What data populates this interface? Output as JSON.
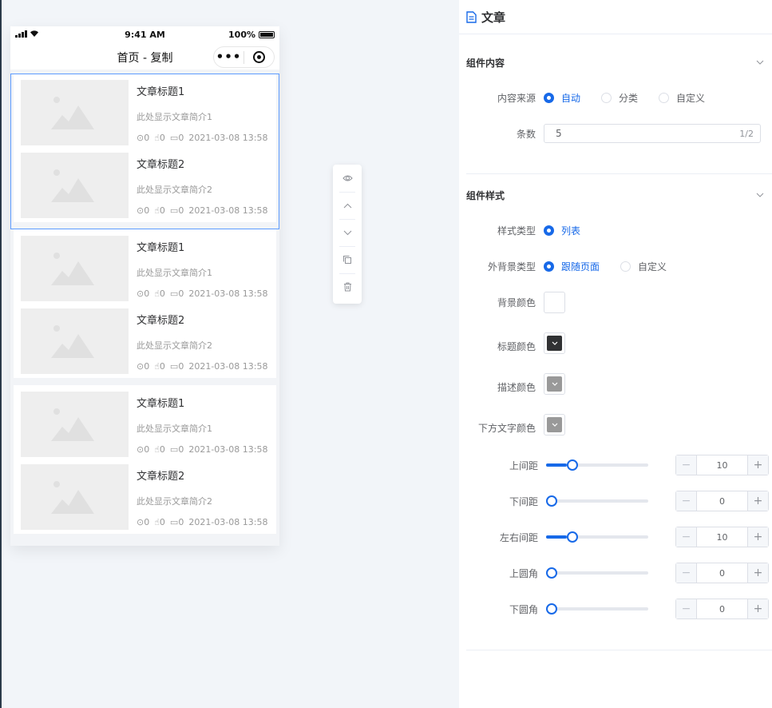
{
  "statusbar": {
    "time": "9:41 AM",
    "battery": "100%"
  },
  "navbar": {
    "title": "首页 - 复制",
    "more_icon": "more-dots-icon",
    "capsule_icon": "target-icon"
  },
  "blocks": [
    {
      "articles": [
        {
          "title": "文章标题1",
          "desc": "此处显示文章简介1",
          "views": "0",
          "likes": "0",
          "comments": "0",
          "time": "2021-03-08 13:58"
        },
        {
          "title": "文章标题2",
          "desc": "此处显示文章简介2",
          "views": "0",
          "likes": "0",
          "comments": "0",
          "time": "2021-03-08 13:58"
        }
      ]
    },
    {
      "articles": [
        {
          "title": "文章标题1",
          "desc": "此处显示文章简介1",
          "views": "0",
          "likes": "0",
          "comments": "0",
          "time": "2021-03-08 13:58"
        },
        {
          "title": "文章标题2",
          "desc": "此处显示文章简介2",
          "views": "0",
          "likes": "0",
          "comments": "0",
          "time": "2021-03-08 13:58"
        }
      ]
    },
    {
      "articles": [
        {
          "title": "文章标题1",
          "desc": "此处显示文章简介1",
          "views": "0",
          "likes": "0",
          "comments": "0",
          "time": "2021-03-08 13:58"
        },
        {
          "title": "文章标题2",
          "desc": "此处显示文章简介2",
          "views": "0",
          "likes": "0",
          "comments": "0",
          "time": "2021-03-08 13:58"
        }
      ]
    }
  ],
  "toolbar": [
    "eye-icon",
    "arrow-up-icon",
    "arrow-down-icon",
    "copy-icon",
    "trash-icon"
  ],
  "panel": {
    "title": "文章",
    "content_section": {
      "title": "组件内容",
      "source_label": "内容来源",
      "source_options": [
        "自动",
        "分类",
        "自定义"
      ],
      "source_selected": "自动",
      "count_label": "条数",
      "count_value": "5",
      "count_counter": "1/2"
    },
    "style_section": {
      "title": "组件样式",
      "style_type_label": "样式类型",
      "style_type_option": "列表",
      "bg_type_label": "外背景类型",
      "bg_type_options": [
        "跟随页面",
        "自定义"
      ],
      "bg_type_selected": "跟随页面",
      "colors": [
        {
          "label": "背景颜色",
          "value": "#ffffff"
        },
        {
          "label": "标题颜色",
          "value": "#303133"
        },
        {
          "label": "描述颜色",
          "value": "#999999"
        },
        {
          "label": "下方文字颜色",
          "value": "#999999"
        }
      ],
      "sliders": [
        {
          "label": "上间距",
          "value": "10",
          "fraction": 0.2
        },
        {
          "label": "下间距",
          "value": "0",
          "fraction": 0
        },
        {
          "label": "左右间距",
          "value": "10",
          "fraction": 0.2
        },
        {
          "label": "上圆角",
          "value": "0",
          "fraction": 0
        },
        {
          "label": "下圆角",
          "value": "0",
          "fraction": 0
        }
      ]
    }
  }
}
